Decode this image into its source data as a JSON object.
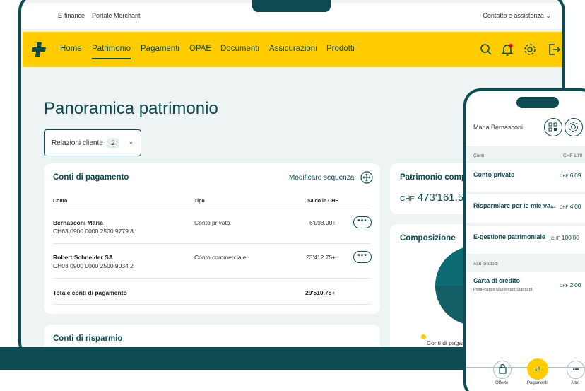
{
  "topbar": {
    "link_efinance": "E-finance",
    "link_merchant": "Portale Merchant",
    "support": "Contatto e assistenza"
  },
  "nav": {
    "items": [
      "Home",
      "Patrimonio",
      "Pagamenti",
      "OPAE",
      "Documenti",
      "Assicurazioni",
      "Prodotti"
    ],
    "active": "Patrimonio",
    "icons": [
      "search-icon",
      "bell-icon",
      "gear-icon",
      "logout-icon"
    ],
    "brand_color": "#ffcc00",
    "accent_color": "#0d4a52",
    "notification_color": "#e2001a"
  },
  "page": {
    "title": "Panoramica patrimonio",
    "relations_label": "Relazioni cliente",
    "relations_count": "2"
  },
  "payment_accounts": {
    "title": "Conti di pagamento",
    "edit_sequence": "Modificare sequenza",
    "columns": [
      "Conto",
      "Tipo",
      "Saldo in CHF"
    ],
    "rows": [
      {
        "name": "Bernasconi Maria",
        "iban": "CH63 0900 0000 2500 9779 8",
        "type": "Conto privato",
        "balance": "6'098.00+"
      },
      {
        "name": "Robert Schneider SA",
        "iban": "CH03 0900 0000 2500 9034 2",
        "type": "Conto commerciale",
        "balance": "23'412.75+"
      }
    ],
    "total_label": "Totale conti di pagamento",
    "total_value": "29'510.75+",
    "more_label": "•••"
  },
  "savings": {
    "title": "Conti di risparmio"
  },
  "assets": {
    "title": "Patrimonio comple",
    "currency": "CHF",
    "value": "473'161.5"
  },
  "composition": {
    "title": "Composizione",
    "legend": "Conti di pagamento",
    "colors": [
      "#0d6b73",
      "#145e66",
      "#ffcc00"
    ]
  },
  "phone": {
    "user": "Maria Bernasconi",
    "header_icons": [
      "qr-code-icon",
      "settings-cog-icon",
      "more-circle-icon"
    ],
    "accounts_label": "Conti",
    "accounts_total": "CHF 10'0",
    "accounts": [
      {
        "title": "Conto privato",
        "currency": "CHF",
        "amount": "6'09"
      },
      {
        "title": "Risparmiare per le mie va...",
        "currency": "CHF",
        "amount": "4'00"
      },
      {
        "title": "E-gestione patrimoniale",
        "currency": "CHF",
        "amount": "100'00"
      }
    ],
    "other_label": "Altri prodotti",
    "card": {
      "title": "Carta di credito",
      "subtitle": "PostFinance Mastercard Standard",
      "currency": "CHF",
      "amount": "2'00"
    },
    "tabs": [
      "Offerte",
      "Pagamenti",
      "Altro"
    ],
    "active_tab": "Pagamenti"
  }
}
